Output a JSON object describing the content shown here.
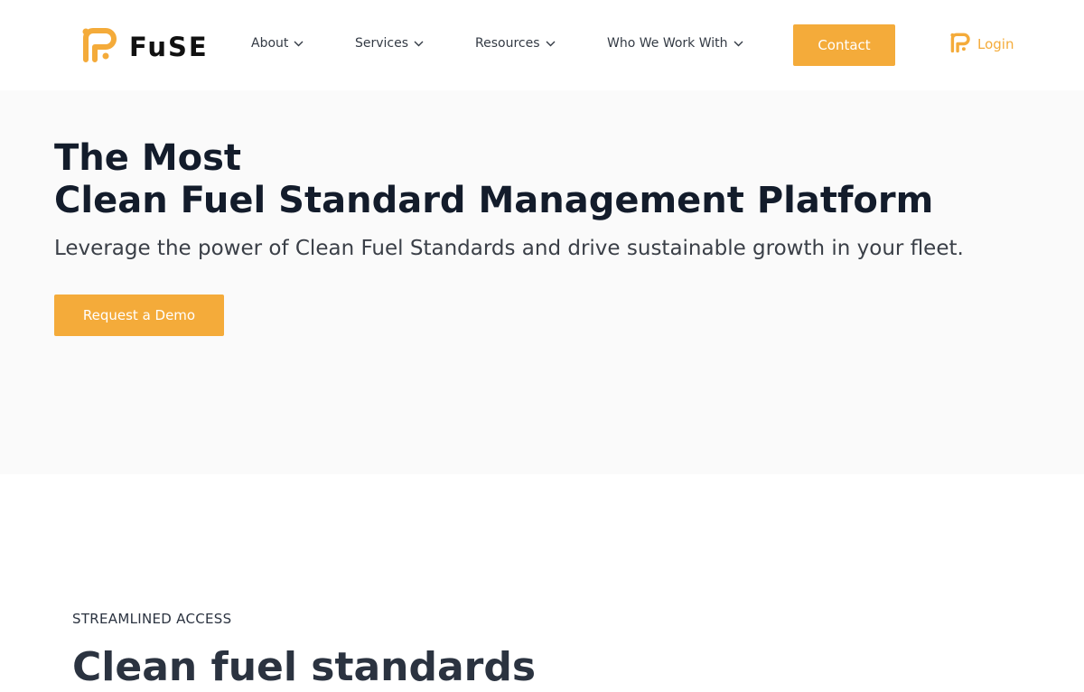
{
  "header": {
    "logo_text": "FuSE",
    "logo_icon": "fuse-logo-icon",
    "nav": [
      {
        "label": "About",
        "icon": "chevron-down-icon"
      },
      {
        "label": "Services",
        "icon": "chevron-down-icon"
      },
      {
        "label": "Resources",
        "icon": "chevron-down-icon"
      },
      {
        "label": "Who We Work With",
        "icon": "chevron-down-icon"
      }
    ],
    "contact_label": "Contact",
    "login_label": "Login"
  },
  "hero": {
    "title_line1": "The Most",
    "title_line2": "Clean Fuel Standard Management Platform",
    "subtitle": "Leverage the power of Clean Fuel Standards and drive sustainable growth in your fleet.",
    "cta_label": "Request a Demo"
  },
  "section": {
    "eyebrow": "STREAMLINED ACCESS",
    "heading": "Clean fuel standards"
  },
  "colors": {
    "accent": "#f4ab3a",
    "heading": "#131c2b",
    "hero_bg": "#fafafa"
  }
}
